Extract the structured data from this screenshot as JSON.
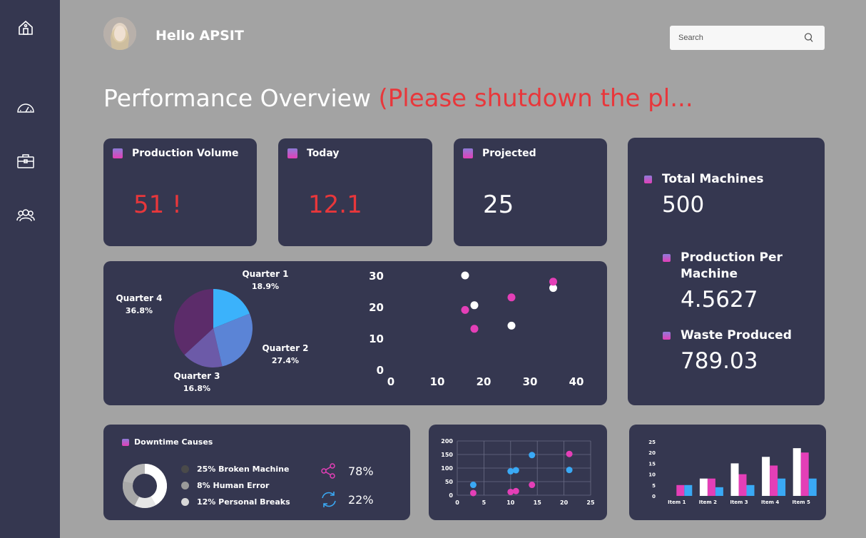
{
  "sidebar": {
    "icons": [
      "home-icon",
      "speedometer-icon",
      "briefcase-icon",
      "users-icon"
    ]
  },
  "header": {
    "greeting": "Hello APSIT",
    "search_placeholder": "Search"
  },
  "page": {
    "title": "Performance Overview",
    "title_note": "(Please shutdown the pl..."
  },
  "kpis": [
    {
      "label": "Production Volume",
      "value": "51 !",
      "color": "#e8373b"
    },
    {
      "label": "Today",
      "value": "12.1",
      "color": "#e8373b"
    },
    {
      "label": "Projected",
      "value": "25",
      "color": "#ffffff"
    }
  ],
  "right_panel": [
    {
      "label": "Total Machines",
      "value": "500"
    },
    {
      "label": "Production Per Machine",
      "value": "4.5627"
    },
    {
      "label": "Waste Produced",
      "value": "789.03"
    }
  ],
  "downtime": {
    "title": "Downtime Causes",
    "items": [
      {
        "label": "25% Broken Machine",
        "color": "#4a4a4a"
      },
      {
        "label": "8% Human Error",
        "color": "#9a9a9a"
      },
      {
        "label": "12% Personal Breaks",
        "color": "#d8d8d8"
      }
    ],
    "stats": [
      {
        "icon": "share-icon",
        "value": "78%",
        "color": "#e43fb7"
      },
      {
        "icon": "refresh-icon",
        "value": "22%",
        "color": "#3aa9f5"
      }
    ]
  },
  "chart_data": [
    {
      "type": "pie",
      "labels": [
        "Quarter 1",
        "Quarter 2",
        "Quarter 3",
        "Quarter 4"
      ],
      "values": [
        18.9,
        27.4,
        16.8,
        36.8
      ],
      "value_labels": [
        "18.9%",
        "27.4%",
        "16.8%",
        "36.8%"
      ],
      "colors": [
        "#3bb2fb",
        "#5b84d6",
        "#6c5aa8",
        "#5c2c6a"
      ]
    },
    {
      "type": "scatter",
      "xlim": [
        0,
        40
      ],
      "ylim": [
        0,
        30
      ],
      "xticks": [
        "0",
        "10",
        "20",
        "30",
        "40"
      ],
      "yticks": [
        "0",
        "10",
        "20",
        "30"
      ],
      "series": [
        {
          "color": "#ffffff",
          "points": [
            [
              16,
              30
            ],
            [
              18,
              20.5
            ],
            [
              26,
              14
            ],
            [
              35,
              26
            ]
          ]
        },
        {
          "color": "#e43fb7",
          "points": [
            [
              16,
              19
            ],
            [
              18,
              13
            ],
            [
              26,
              23
            ],
            [
              35,
              28
            ]
          ]
        }
      ]
    },
    {
      "type": "scatter",
      "xlim": [
        0,
        25
      ],
      "ylim": [
        0,
        200
      ],
      "xticks": [
        "0",
        "5",
        "10",
        "15",
        "20",
        "25"
      ],
      "yticks": [
        "0",
        "50",
        "100",
        "150",
        "200"
      ],
      "grid": true,
      "series": [
        {
          "color": "#3aa9f5",
          "points": [
            [
              3,
              38
            ],
            [
              10,
              88
            ],
            [
              11,
              92
            ],
            [
              14,
              148
            ],
            [
              21,
              93
            ]
          ]
        },
        {
          "color": "#e43fb7",
          "points": [
            [
              3,
              8
            ],
            [
              10,
              12
            ],
            [
              11,
              15
            ],
            [
              14,
              38
            ],
            [
              21,
              152
            ]
          ]
        }
      ]
    },
    {
      "type": "bar",
      "categories": [
        "Item 1",
        "Item 2",
        "Item 3",
        "Item 4",
        "Item 5"
      ],
      "ylim": [
        0,
        25
      ],
      "yticks": [
        "0",
        "5",
        "10",
        "15",
        "20",
        "25"
      ],
      "series": [
        {
          "color": "#ffffff",
          "values": [
            0,
            8,
            15,
            18,
            22
          ]
        },
        {
          "color": "#e43fb7",
          "values": [
            5,
            8,
            10,
            14,
            20
          ]
        },
        {
          "color": "#3aa9f5",
          "values": [
            5,
            4,
            5,
            8,
            8
          ]
        }
      ]
    }
  ]
}
